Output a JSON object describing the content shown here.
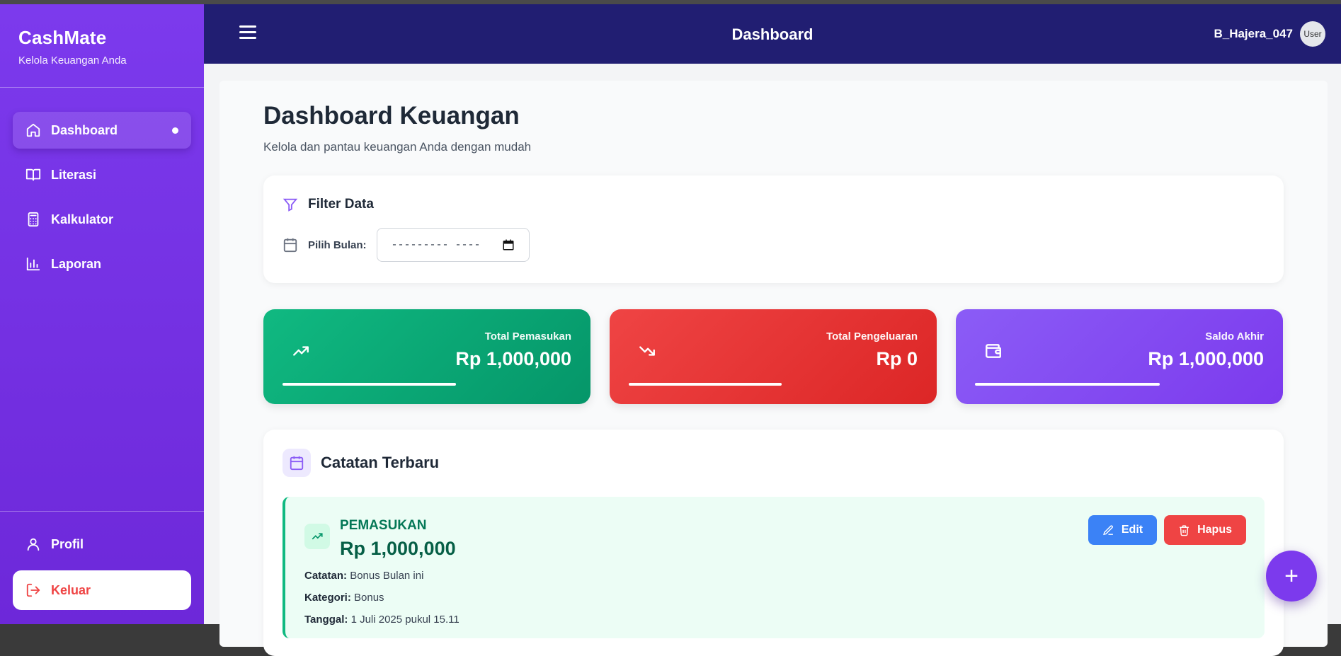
{
  "sidebar": {
    "brand_title": "CashMate",
    "brand_subtitle": "Kelola Keuangan Anda",
    "items": [
      {
        "label": "Dashboard",
        "icon": "home-icon",
        "active": true
      },
      {
        "label": "Literasi",
        "icon": "book-icon"
      },
      {
        "label": "Kalkulator",
        "icon": "calculator-icon"
      },
      {
        "label": "Laporan",
        "icon": "bar-chart-icon"
      }
    ],
    "profile_label": "Profil",
    "logout_label": "Keluar"
  },
  "header": {
    "title": "Dashboard",
    "username": "B_Hajera_047",
    "avatar_alt": "User"
  },
  "page": {
    "title": "Dashboard Keuangan",
    "subtitle": "Kelola dan pantau keuangan Anda dengan mudah"
  },
  "filter": {
    "title": "Filter Data",
    "month_label": "Pilih Bulan:",
    "month_value": "--------- ----"
  },
  "stats": [
    {
      "label": "Total Pemasukan",
      "value": "Rp 1,000,000",
      "color": "#10b981",
      "icon": "trending-up-icon",
      "bar_fill": 0.6
    },
    {
      "label": "Total Pengeluaran",
      "value": "Rp 0",
      "color": "#ef4444",
      "icon": "trending-down-icon",
      "bar_fill": 0.53
    },
    {
      "label": "Saldo Akhir",
      "value": "Rp 1,000,000",
      "color": "#8b5cf6",
      "icon": "wallet-icon",
      "bar_fill": 0.64
    }
  ],
  "records": {
    "title": "Catatan Terbaru",
    "items": [
      {
        "type": "PEMASUKAN",
        "amount": "Rp 1,000,000",
        "note_label": "Catatan:",
        "note": "Bonus Bulan ini",
        "category_label": "Kategori:",
        "category": "Bonus",
        "date_label": "Tanggal:",
        "date": "1 Juli 2025 pukul 15.11",
        "edit_label": "Edit",
        "delete_label": "Hapus"
      }
    ]
  },
  "fab_label": "+"
}
